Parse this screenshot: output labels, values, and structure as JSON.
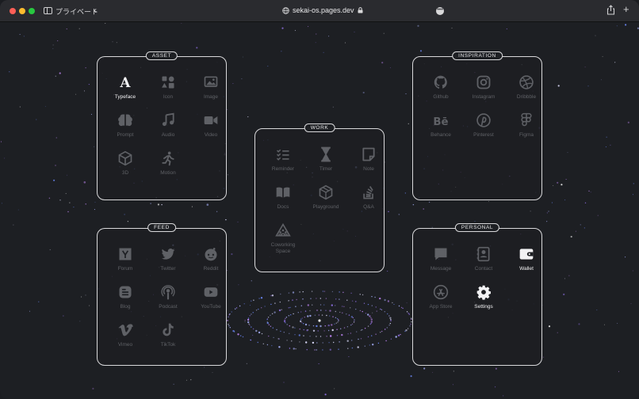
{
  "browser": {
    "tab_label": "プライベート",
    "url": "sekai-os.pages.dev"
  },
  "colors": {
    "active": "#f2f2f4",
    "inactive": "#5f6166",
    "border": "#d9d9db"
  },
  "cards": {
    "asset": {
      "title": "ASSET",
      "items": [
        {
          "label": "Typeface",
          "icon": "typeface-icon",
          "active": true
        },
        {
          "label": "Icon",
          "icon": "shapes-icon",
          "active": false
        },
        {
          "label": "Image",
          "icon": "image-icon",
          "active": false
        },
        {
          "label": "Prompt",
          "icon": "brain-icon",
          "active": false
        },
        {
          "label": "Audio",
          "icon": "music-icon",
          "active": false
        },
        {
          "label": "Video",
          "icon": "video-camera-icon",
          "active": false
        },
        {
          "label": "3D",
          "icon": "cube-3d-icon",
          "active": false
        },
        {
          "label": "Motion",
          "icon": "running-person-icon",
          "active": false
        }
      ]
    },
    "work": {
      "title": "WORK",
      "items": [
        {
          "label": "Reminder",
          "icon": "checklist-icon",
          "active": false
        },
        {
          "label": "Timer",
          "icon": "hourglass-icon",
          "active": false
        },
        {
          "label": "Note",
          "icon": "note-icon",
          "active": false
        },
        {
          "label": "Docs",
          "icon": "book-icon",
          "active": false
        },
        {
          "label": "Playground",
          "icon": "box-icon",
          "active": false
        },
        {
          "label": "Q&A",
          "icon": "stack-overflow-icon",
          "active": false
        },
        {
          "label": "Coworking\nSpace",
          "icon": "group-tent-icon",
          "active": false
        }
      ]
    },
    "inspiration": {
      "title": "INSPIRATION",
      "items": [
        {
          "label": "Github",
          "icon": "github-icon",
          "active": false
        },
        {
          "label": "Instagram",
          "icon": "instagram-icon",
          "active": false
        },
        {
          "label": "Dribbble",
          "icon": "dribbble-icon",
          "active": false
        },
        {
          "label": "Behance",
          "icon": "behance-icon",
          "active": false
        },
        {
          "label": "Pinterest",
          "icon": "pinterest-icon",
          "active": false
        },
        {
          "label": "Figma",
          "icon": "figma-icon",
          "active": false
        }
      ]
    },
    "feed": {
      "title": "FEED",
      "items": [
        {
          "label": "Forum",
          "icon": "hacker-news-icon",
          "active": false
        },
        {
          "label": "Twitter",
          "icon": "twitter-icon",
          "active": false
        },
        {
          "label": "Reddit",
          "icon": "reddit-icon",
          "active": false
        },
        {
          "label": "Blog",
          "icon": "blogger-icon",
          "active": false
        },
        {
          "label": "Podcast",
          "icon": "podcast-icon",
          "active": false
        },
        {
          "label": "YouTube",
          "icon": "youtube-icon",
          "active": false
        },
        {
          "label": "Vimeo",
          "icon": "vimeo-icon",
          "active": false
        },
        {
          "label": "TikTok",
          "icon": "tiktok-icon",
          "active": false
        }
      ]
    },
    "personal": {
      "title": "PERSONAL",
      "items": [
        {
          "label": "Message",
          "icon": "message-icon",
          "active": false
        },
        {
          "label": "Contact",
          "icon": "contact-book-icon",
          "active": false
        },
        {
          "label": "Wallet",
          "icon": "wallet-icon",
          "active": true
        },
        {
          "label": "App Store",
          "icon": "app-store-icon",
          "active": false
        },
        {
          "label": "Settings",
          "icon": "gear-icon",
          "active": true
        }
      ]
    }
  }
}
